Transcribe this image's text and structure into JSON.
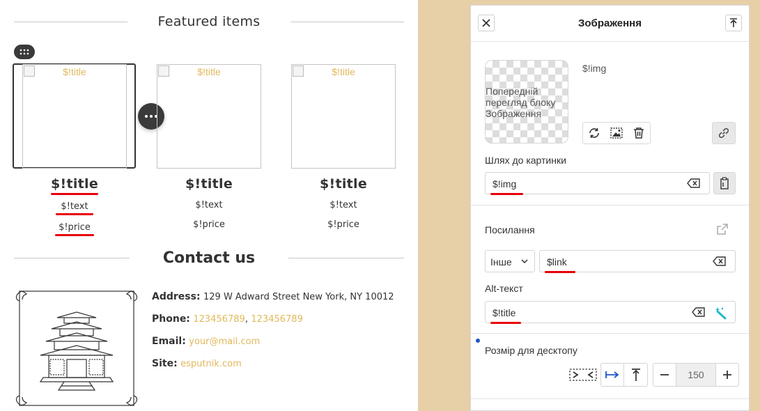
{
  "canvas": {
    "featured_heading": "Featured items",
    "products": [
      {
        "image_alt": "$!title",
        "title": "$!title",
        "text": "$!text",
        "price": "$!price"
      },
      {
        "image_alt": "$!title",
        "title": "$!title",
        "text": "$!text",
        "price": "$!price"
      },
      {
        "image_alt": "$!title",
        "title": "$!title",
        "text": "$!text",
        "price": "$!price"
      }
    ],
    "contact_heading": "Contact us",
    "contact": {
      "address_label": "Address:",
      "address_value": "129 W Adward Street New York, NY 10012",
      "phone_label": "Phone:",
      "phone_1": "123456789",
      "phone_sep": ",",
      "phone_2": "123456789",
      "email_label": "Email:",
      "email_value": "your@mail.com",
      "site_label": "Site:",
      "site_value": "esputnik.com"
    }
  },
  "panel": {
    "title": "Зображення",
    "preview_alt": "Попередній перегляд блоку Зображення",
    "image_variable": "$!img",
    "image_path_label": "Шлях до картинки",
    "image_path_value": "$!img",
    "link_label": "Посилання",
    "link_type": "Інше",
    "link_value": "$link",
    "alt_label": "Alt-текст",
    "alt_value": "$!title",
    "desktop_size_label": "Розмір для десктопу",
    "desktop_size_value": "150"
  },
  "colors": {
    "accent_link": "#e0b95c",
    "panel_background": "#e7cfa8",
    "underline_red": "#e8000b",
    "active_blue": "#1e56c5"
  },
  "icons": [
    "drag-dots-icon",
    "more-dots-icon",
    "close-icon",
    "pin-icon",
    "refresh-icon",
    "image-edit-icon",
    "trash-icon",
    "link-icon",
    "clear-icon",
    "paste-icon",
    "external-link-icon",
    "chevron-down-icon",
    "magic-wand-icon",
    "fit-icon",
    "fill-width-icon",
    "align-top-icon",
    "minus-icon",
    "plus-icon"
  ]
}
